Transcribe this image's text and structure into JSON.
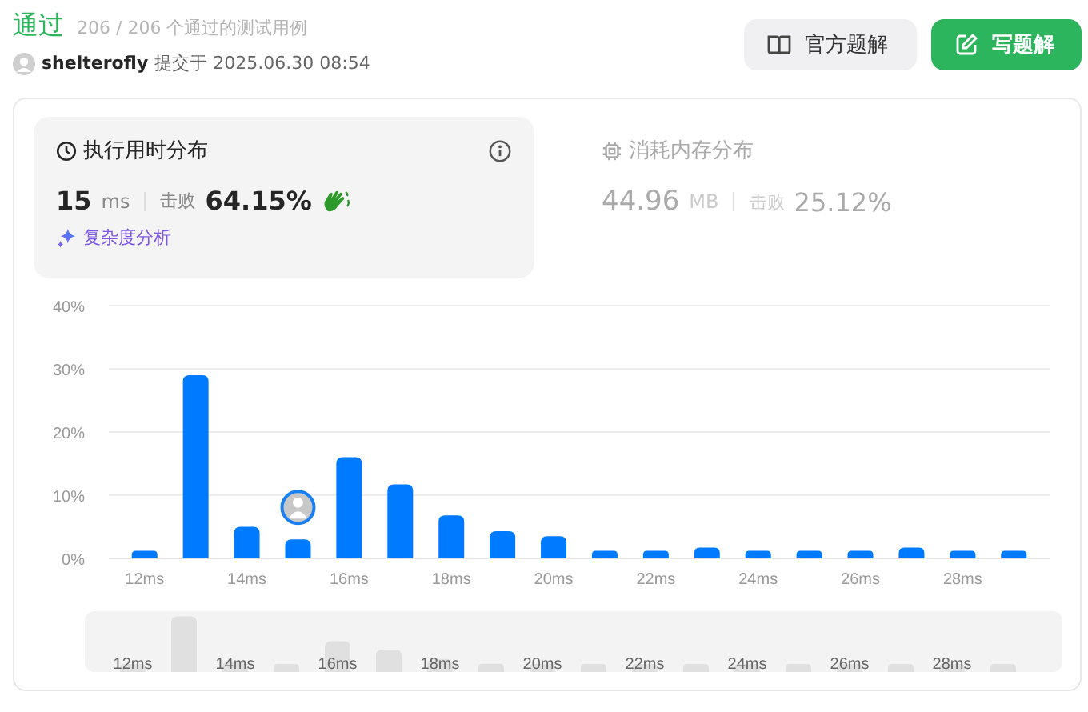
{
  "header": {
    "status": "通过",
    "tests": "206 / 206 个通过的测试用例",
    "user": "shelterofly",
    "submitted": "提交于 2025.06.30 08:54"
  },
  "buttons": [
    {
      "kind": "solution",
      "label": "官方题解"
    },
    {
      "kind": "write",
      "label": "写题解"
    }
  ],
  "panels": [
    {
      "kind": "runtime",
      "title": "执行用时分布",
      "selected": true,
      "value": "15",
      "unit": "ms",
      "beat_label": "击败",
      "beat_value": "64.15%",
      "link": "复杂度分析"
    },
    {
      "kind": "memory",
      "title": "消耗内存分布",
      "selected": false,
      "value": "44.96",
      "unit": "MB",
      "beat_label": "击败",
      "beat_value": "25.12%"
    }
  ],
  "chart": {
    "chart_data": {
      "type": "bar",
      "grid": true,
      "x": [
        12,
        13,
        14,
        15,
        16,
        17,
        18,
        19,
        20,
        21,
        22,
        23,
        24,
        25,
        26,
        27,
        28,
        29
      ],
      "series": [
        {
          "color": "#007aff",
          "values": [
            1.2,
            29,
            5,
            3,
            16,
            11.7,
            6.8,
            4.3,
            3.5,
            1.2,
            1.2,
            1.7,
            1.2,
            1.2,
            1.2,
            1.7,
            1.2,
            1.2
          ]
        }
      ],
      "xlim": [
        11.3,
        29.7
      ],
      "ylim": [
        0,
        40
      ],
      "yticks": [
        {
          "value": 0,
          "label": "0%"
        },
        {
          "value": 10,
          "label": "10%"
        },
        {
          "value": 20,
          "label": "20%"
        },
        {
          "value": 30,
          "label": "30%"
        },
        {
          "value": 40,
          "label": "40%"
        }
      ],
      "xticks": [
        {
          "value": 12,
          "label": "12ms"
        },
        {
          "value": 14,
          "label": "14ms"
        },
        {
          "value": 16,
          "label": "16ms"
        },
        {
          "value": 18,
          "label": "18ms"
        },
        {
          "value": 20,
          "label": "20ms"
        },
        {
          "value": 22,
          "label": "22ms"
        },
        {
          "value": 24,
          "label": "24ms"
        },
        {
          "value": 26,
          "label": "26ms"
        },
        {
          "value": 28,
          "label": "28ms"
        }
      ]
    }
  },
  "navigator": {
    "labels": [
      "12ms",
      "14ms",
      "16ms",
      "18ms",
      "20ms",
      "22ms",
      "24ms",
      "26ms",
      "28ms"
    ]
  }
}
